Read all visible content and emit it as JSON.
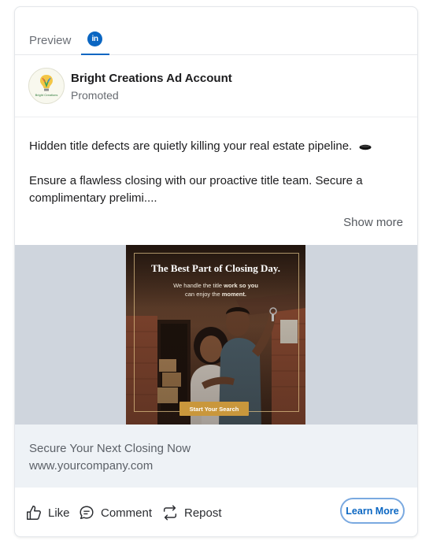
{
  "tabs": {
    "preview_label": "Preview",
    "linkedin_icon_text": "in",
    "accent": "#0a66c2"
  },
  "post": {
    "account_name": "Bright Creations Ad Account",
    "promoted_label": "Promoted",
    "avatar_logo_text": "Bright Creations",
    "text_line1": "Hidden title defects are quietly killing your real estate pipeline.",
    "text_line2": "Ensure a flawless closing with our proactive title team. Secure a complimentary prelimi....",
    "show_more": "Show more"
  },
  "ad_creative": {
    "headline": "The Best Part of Closing Day.",
    "subtext_pre": "We handle the title ",
    "subtext_bold": "work so you",
    "subtext_line2_pre": "can enjoy the ",
    "subtext_line2_bold": "moment.",
    "cta": "Start Your Search",
    "cta_color": "#c9973c"
  },
  "link_preview": {
    "headline": "Secure Your Next Closing Now",
    "domain": "www.yourcompany.com"
  },
  "actions": {
    "like": "Like",
    "comment": "Comment",
    "repost": "Repost",
    "cta_button": "Learn More"
  }
}
